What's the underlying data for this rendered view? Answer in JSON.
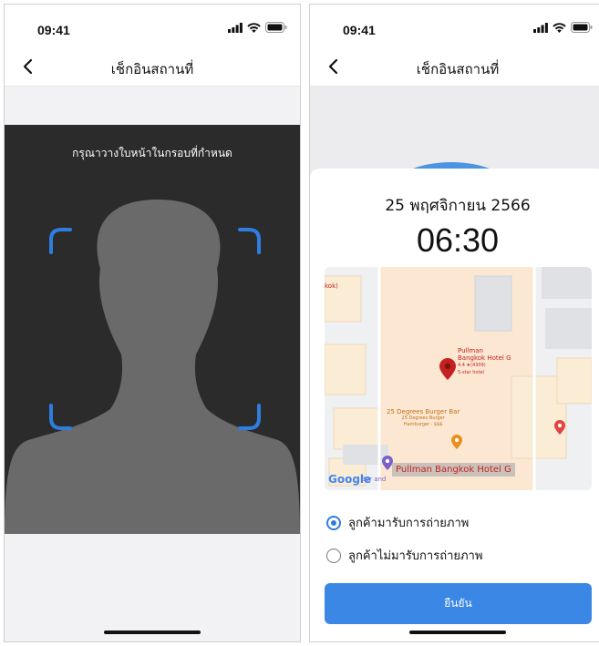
{
  "left": {
    "status_time": "09:41",
    "title": "เช็กอินสถานที่",
    "guide_text": "กรุณาวางใบหน้าในกรอบที่กำหนด"
  },
  "right": {
    "status_time": "09:41",
    "title": "เช็กอินสถานที่",
    "date": "25 พฤศจิกายน 2566",
    "time": "06:30",
    "map": {
      "place_name": "Pullman Bangkok Hotel G",
      "place_label_line1": "Pullman",
      "place_label_line2": "Bangkok Hotel G",
      "place_rating": "4.4 ★(4309)",
      "place_type": "5-star hotel",
      "restaurant_name": "25 Degrees Burger Bar",
      "restaurant_sub1": "25 Degrees Burger",
      "restaurant_sub2": "Hamburger · $$$",
      "edge_label": "kok)",
      "bottom_label": "Bar and",
      "logo": "Google"
    },
    "options": [
      {
        "label": "ลูกค้ามารับการถ่ายภาพ",
        "selected": true
      },
      {
        "label": "ลูกค้าไม่มารับการถ่ายภาพ",
        "selected": false
      }
    ],
    "confirm_label": "ยืนยัน"
  },
  "colors": {
    "accent": "#3b87e6",
    "frame_corner": "#2f7de1",
    "camera_bg": "#2b2b2b"
  }
}
